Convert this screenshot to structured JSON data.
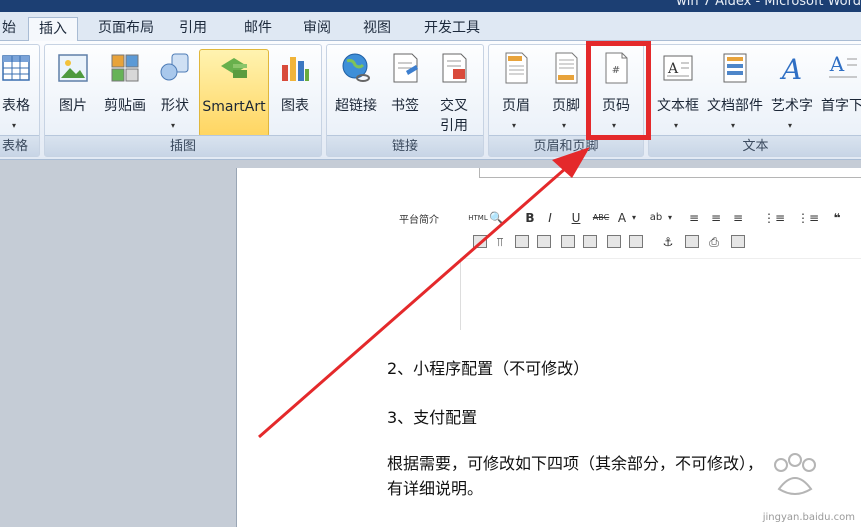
{
  "window": {
    "title": "win 7 Aidex - Microsoft Word"
  },
  "tabs": [
    {
      "label": "始"
    },
    {
      "label": "插入"
    },
    {
      "label": "页面布局"
    },
    {
      "label": "引用"
    },
    {
      "label": "邮件"
    },
    {
      "label": "审阅"
    },
    {
      "label": "视图"
    },
    {
      "label": "开发工具"
    }
  ],
  "ribbon": {
    "groups": [
      {
        "label": "表格",
        "buttons": [
          {
            "label": "表格",
            "icon": "table-icon"
          }
        ]
      },
      {
        "label": "插图",
        "buttons": [
          {
            "label": "图片",
            "icon": "picture-icon"
          },
          {
            "label": "剪贴画",
            "icon": "clipart-icon"
          },
          {
            "label": "形状",
            "icon": "shapes-icon"
          },
          {
            "label": "SmartArt",
            "icon": "smartart-icon"
          },
          {
            "label": "图表",
            "icon": "chart-icon"
          }
        ]
      },
      {
        "label": "链接",
        "buttons": [
          {
            "label": "超链接",
            "icon": "hyperlink-icon"
          },
          {
            "label": "书签",
            "icon": "bookmark-icon"
          },
          {
            "label": "交叉",
            "label2": "引用",
            "icon": "cross-reference-icon"
          }
        ]
      },
      {
        "label": "页眉和页脚",
        "buttons": [
          {
            "label": "页眉",
            "icon": "header-icon"
          },
          {
            "label": "页脚",
            "icon": "footer-icon"
          },
          {
            "label": "页码",
            "icon": "page-number-icon"
          }
        ]
      },
      {
        "label": "文本",
        "buttons": [
          {
            "label": "文本框",
            "icon": "textbox-icon"
          },
          {
            "label": "文档部件",
            "icon": "quickparts-icon"
          },
          {
            "label": "艺术字",
            "icon": "wordart-icon"
          },
          {
            "label": "首字下",
            "icon": "dropcap-icon"
          }
        ]
      }
    ]
  },
  "editor": {
    "label": "平台简介",
    "toolbar_row1": [
      "HTML",
      "B",
      "I",
      "U",
      "ABC",
      "A",
      "ab"
    ],
    "accent": "#e4292b"
  },
  "document": {
    "lines": [
      "2、小程序配置（不可修改）",
      "3、支付配置",
      "根据需要，可修改如下四项（其余部分，不可修改），",
      "有详细说明。"
    ]
  },
  "watermark": {
    "text": "jingyan.baidu.com"
  }
}
